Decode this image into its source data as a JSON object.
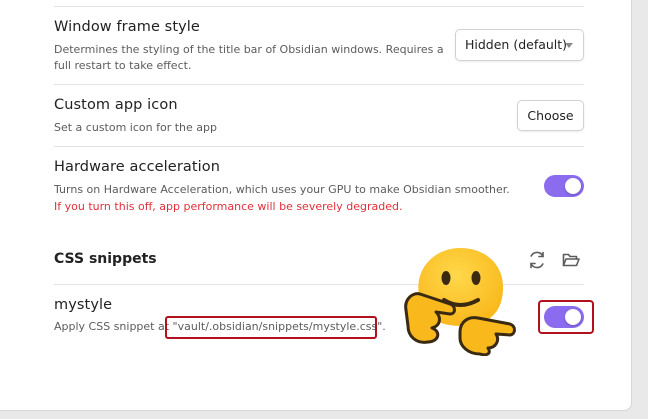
{
  "settings": {
    "window_frame": {
      "name": "Window frame style",
      "desc_line1": "Determines the styling of the title bar of Obsidian windows. Requires a",
      "desc_line2": "full restart to take effect.",
      "dropdown_value": "Hidden (default)"
    },
    "app_icon": {
      "name": "Custom app icon",
      "desc": "Set a custom icon for the app",
      "button_label": "Choose"
    },
    "hw_accel": {
      "name": "Hardware acceleration",
      "desc": "Turns on Hardware Acceleration, which uses your GPU to make Obsidian smoother.",
      "warning": "If you turn this off, app performance will be severely degraded.",
      "enabled": true
    }
  },
  "css_snippets": {
    "heading": "CSS snippets",
    "snippet": {
      "name": "mystyle",
      "desc_prefix": "Apply CSS snippet at ",
      "path": "\"vault/.obsidian/snippets/mystyle.css\".",
      "enabled": true
    }
  },
  "icons": {
    "reload": "refresh-icon",
    "folder": "folder-open-icon",
    "emoji": "thinking-hands-emoji"
  },
  "colors": {
    "accent": "#8b6cef",
    "warning": "#e0303a",
    "highlight": "#b0111c"
  }
}
